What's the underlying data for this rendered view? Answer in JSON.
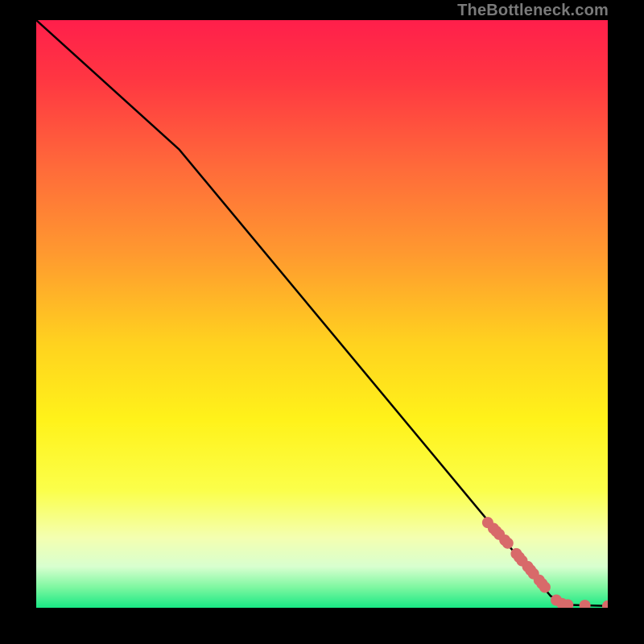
{
  "watermark": "TheBottleneck.com",
  "chart_data": {
    "type": "line",
    "xlim": [
      0,
      100
    ],
    "ylim": [
      0,
      100
    ],
    "title": "",
    "xlabel": "",
    "ylabel": "",
    "gradient_stops": [
      {
        "offset": 0,
        "color": "#ff1f4b"
      },
      {
        "offset": 0.1,
        "color": "#ff3642"
      },
      {
        "offset": 0.25,
        "color": "#ff6a3a"
      },
      {
        "offset": 0.4,
        "color": "#ff9a2f"
      },
      {
        "offset": 0.55,
        "color": "#ffd21f"
      },
      {
        "offset": 0.68,
        "color": "#fff21a"
      },
      {
        "offset": 0.8,
        "color": "#fbff4a"
      },
      {
        "offset": 0.88,
        "color": "#f4ffb0"
      },
      {
        "offset": 0.93,
        "color": "#d8ffcf"
      },
      {
        "offset": 0.965,
        "color": "#7ef7a1"
      },
      {
        "offset": 1.0,
        "color": "#19e884"
      }
    ],
    "series": [
      {
        "name": "curve",
        "type": "line",
        "points": [
          {
            "x": 0,
            "y": 100
          },
          {
            "x": 25,
            "y": 78
          },
          {
            "x": 90,
            "y": 2
          },
          {
            "x": 93,
            "y": 0.5
          },
          {
            "x": 100,
            "y": 0.3
          }
        ]
      },
      {
        "name": "markers",
        "type": "scatter",
        "color": "#d86a6a",
        "points": [
          {
            "x": 79,
            "y": 14.5
          },
          {
            "x": 80,
            "y": 13.5
          },
          {
            "x": 80.5,
            "y": 13
          },
          {
            "x": 81,
            "y": 12.5
          },
          {
            "x": 82,
            "y": 11.5
          },
          {
            "x": 82.5,
            "y": 11
          },
          {
            "x": 84,
            "y": 9.2
          },
          {
            "x": 84.5,
            "y": 8.6
          },
          {
            "x": 85,
            "y": 8.0
          },
          {
            "x": 86,
            "y": 7.0
          },
          {
            "x": 86.5,
            "y": 6.4
          },
          {
            "x": 87,
            "y": 5.8
          },
          {
            "x": 88,
            "y": 4.7
          },
          {
            "x": 88.5,
            "y": 4.1
          },
          {
            "x": 89,
            "y": 3.5
          },
          {
            "x": 91,
            "y": 1.3
          },
          {
            "x": 92,
            "y": 0.7
          },
          {
            "x": 93,
            "y": 0.5
          },
          {
            "x": 96,
            "y": 0.4
          },
          {
            "x": 100,
            "y": 0.3
          }
        ]
      }
    ]
  }
}
